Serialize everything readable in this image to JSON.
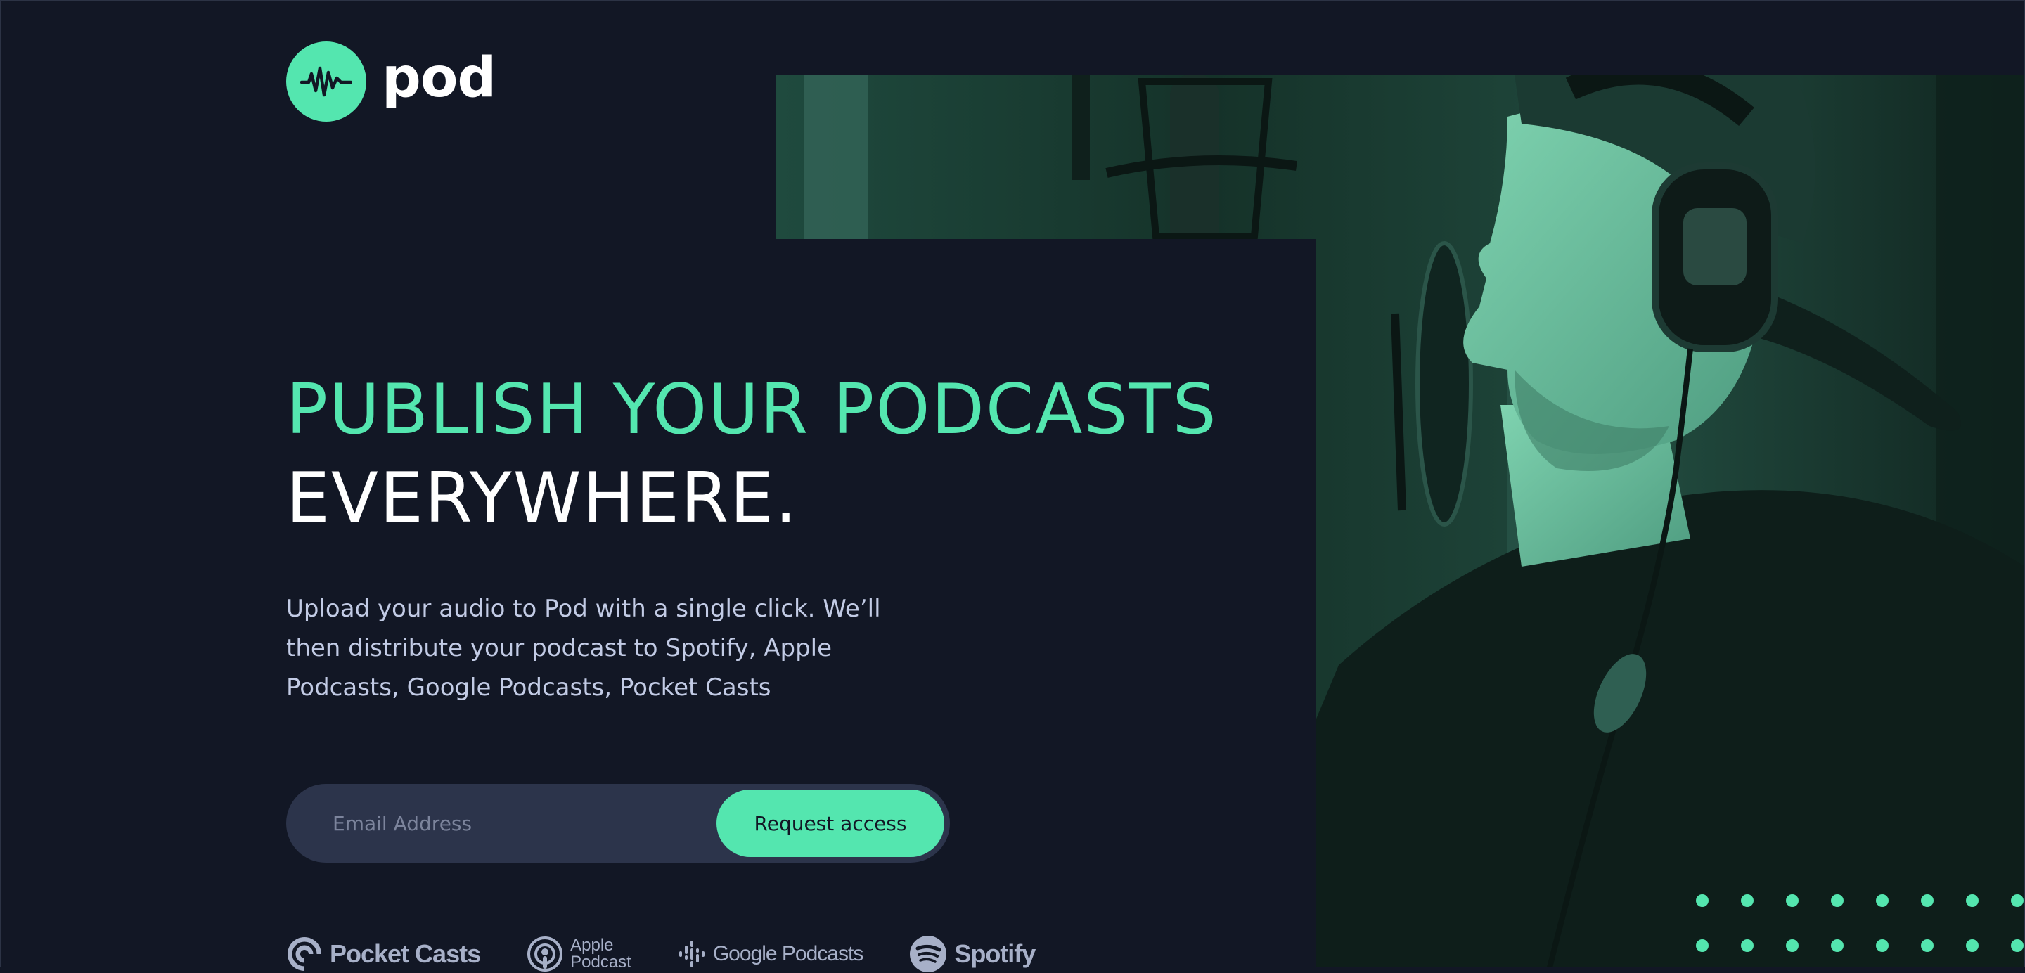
{
  "brand": {
    "name": "pod",
    "accent_color": "#54E6AF",
    "background_color": "#121725"
  },
  "hero": {
    "headline_line1": "PUBLISH YOUR PODCASTS",
    "headline_line2": "EVERYWHERE.",
    "description": "Upload your audio to Pod with a single click. We’ll then distribute your podcast to Spotify, Apple Podcasts, Google Podcasts, Pocket Casts"
  },
  "form": {
    "email_placeholder": "Email Address",
    "email_value": "",
    "submit_label": "Request access"
  },
  "platforms": [
    {
      "name": "Pocket Casts",
      "icon": "pocket-casts-icon"
    },
    {
      "name_line1": "Apple",
      "name_line2": "Podcast",
      "icon": "apple-podcasts-icon"
    },
    {
      "name": "Google Podcasts",
      "icon": "google-podcasts-icon"
    },
    {
      "name": "Spotify",
      "icon": "spotify-icon"
    }
  ],
  "image": {
    "subject": "man with headphones speaking into studio microphone"
  }
}
